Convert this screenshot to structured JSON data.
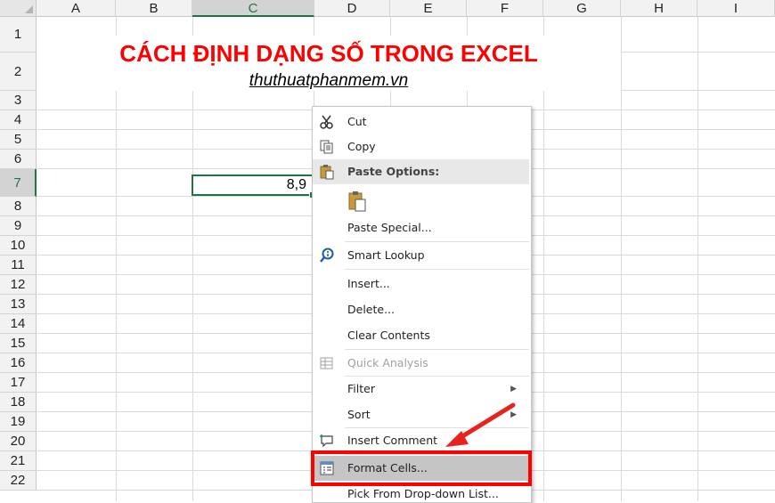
{
  "columns": [
    "A",
    "B",
    "C",
    "D",
    "E",
    "F",
    "G",
    "H",
    "I"
  ],
  "rows": [
    "1",
    "2",
    "3",
    "4",
    "5",
    "6",
    "7",
    "8",
    "9",
    "10",
    "11",
    "12",
    "13",
    "14",
    "15",
    "16",
    "17",
    "18",
    "19",
    "20",
    "21",
    "22"
  ],
  "active_column": "C",
  "active_row": "7",
  "sheet": {
    "title": "CÁCH ĐỊNH DẠNG SỐ TRONG EXCEL",
    "subtitle": "thuthuatphanmem.vn",
    "selected_cell_value": "8,9"
  },
  "context_menu": {
    "items": [
      {
        "label": "Cut",
        "icon": "scissors-icon"
      },
      {
        "label": "Copy",
        "icon": "copy-icon"
      },
      {
        "label": "Paste Options:",
        "icon": "paste-icon"
      },
      {
        "label": "Paste Special...",
        "icon": ""
      },
      {
        "label": "Smart Lookup",
        "icon": "smart-lookup-icon"
      },
      {
        "label": "Insert...",
        "icon": ""
      },
      {
        "label": "Delete...",
        "icon": ""
      },
      {
        "label": "Clear Contents",
        "icon": ""
      },
      {
        "label": "Quick Analysis",
        "icon": "quick-analysis-icon"
      },
      {
        "label": "Filter",
        "icon": ""
      },
      {
        "label": "Sort",
        "icon": ""
      },
      {
        "label": "Insert Comment",
        "icon": "insert-comment-icon"
      },
      {
        "label": "Format Cells...",
        "icon": "format-cells-icon"
      },
      {
        "label": "Pick From Drop-down List...",
        "icon": ""
      }
    ]
  },
  "colors": {
    "title": "#ff0000",
    "annotation": "#ff0000",
    "selection": "#217346"
  }
}
